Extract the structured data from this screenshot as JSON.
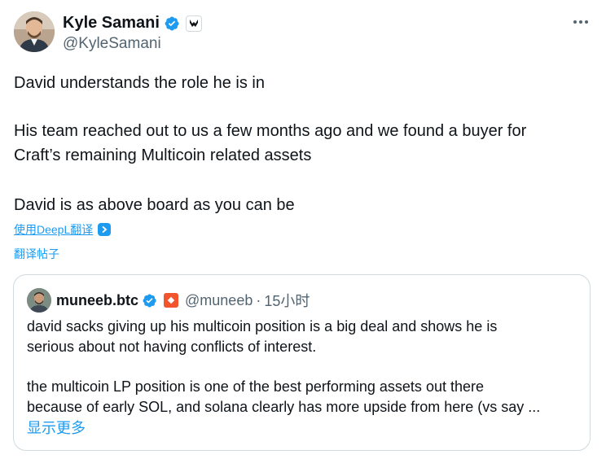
{
  "author": {
    "name": "Kyle Samani",
    "handle": "@KyleSamani"
  },
  "post": {
    "paragraphs": [
      "David understands the role he is in",
      "His team reached out to us a few months ago and we found a buyer for",
      "Craft’s remaining Multicoin related assets",
      "David is as above board as you can be"
    ],
    "translate_with_deepl": "使用DeepL翻译",
    "translate_post": "翻译帖子"
  },
  "quote": {
    "name": "muneeb.btc",
    "handle": "@muneeb",
    "separator": "·",
    "time": "15小时",
    "lines": [
      "david sacks giving up his multicoin position is a big deal and shows he is",
      "serious about not having conflicts of interest.",
      "the multicoin LP position is one of the best performing assets out there",
      "because of early SOL, and solana clearly has more upside from here (vs say ..."
    ],
    "show_more": "显示更多"
  },
  "icons": {
    "verified": "verified-badge-icon",
    "affiliation": "affiliation-badge-icon",
    "more": "more-options-icon",
    "deepl": "deepl-icon"
  },
  "colors": {
    "accent": "#1d9bf0",
    "text": "#0f1419",
    "muted": "#536471",
    "border": "#cfd9de"
  }
}
